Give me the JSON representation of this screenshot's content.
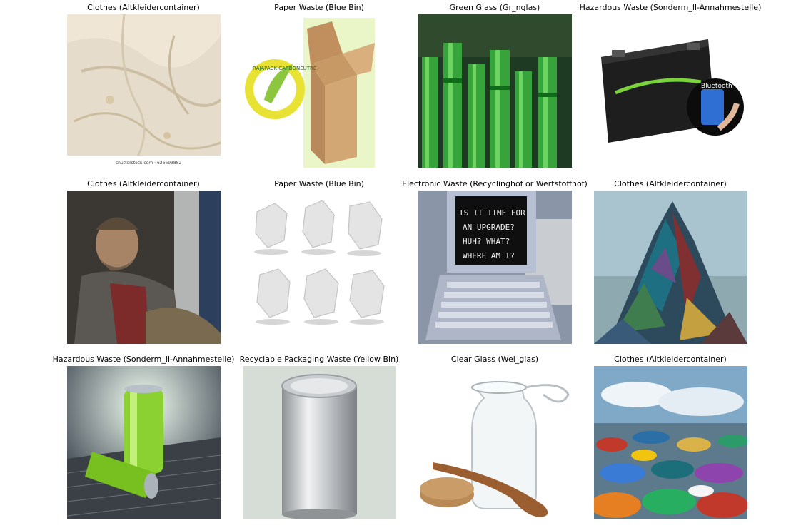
{
  "grid": [
    {
      "title": "Clothes (Altkleidercontainer)",
      "icon": "crumpled-shirt-photo",
      "watermark": "shutterstock.com · 626693882"
    },
    {
      "title": "Paper Waste (Blue Bin)",
      "icon": "cardboard-box-photo",
      "badge": "RAJAPACK CARBONEUTRE"
    },
    {
      "title": "Green Glass (Gr_nglas)",
      "icon": "green-bottles-photo"
    },
    {
      "title": "Hazardous Waste (Sonderm_ll-Annahmestelle)",
      "icon": "battery-photo",
      "badge": "Bluetooth"
    },
    {
      "title": "Clothes (Altkleidercontainer)",
      "icon": "sleeping-man-photo"
    },
    {
      "title": "Paper Waste (Blue Bin)",
      "icon": "crumpled-paper-photo"
    },
    {
      "title": "Electronic Waste (Recyclinghof or Wertstoffhof)",
      "icon": "old-laptop-photo",
      "screen_lines": [
        "IS IT TIME FOR",
        "AN UPGRADE?",
        "HUH? WHAT?",
        "WHERE AM I?"
      ]
    },
    {
      "title": "Clothes (Altkleidercontainer)",
      "icon": "clothes-mountain-photo"
    },
    {
      "title": "Hazardous Waste (Sonderm_ll-Annahmestelle)",
      "icon": "green-batteries-photo"
    },
    {
      "title": "Recyclable Packaging Waste (Yellow Bin)",
      "icon": "tin-can-photo"
    },
    {
      "title": "Clear Glass (Wei_glas)",
      "icon": "glass-jar-photo"
    },
    {
      "title": "Clothes (Altkleidercontainer)",
      "icon": "clothes-landfill-photo"
    }
  ]
}
